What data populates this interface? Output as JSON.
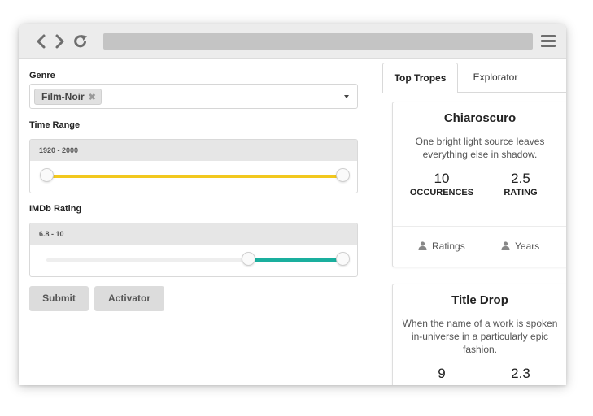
{
  "browser": {
    "icons": [
      "chevron-left-icon",
      "chevron-right-icon",
      "reload-icon",
      "hamburger-menu-icon"
    ]
  },
  "form": {
    "genre_label": "Genre",
    "genre_chip": "Film-Noir",
    "genre_chip_remove": "✖",
    "time_range_label": "Time Range",
    "time_range_value": "1920 - 2000",
    "time_range": {
      "min_fraction": 0.0,
      "max_fraction": 1.0,
      "color": "#f2c81e"
    },
    "imdb_label": "IMDb Rating",
    "imdb_value": "6.8 - 10",
    "imdb": {
      "min_fraction": 0.68,
      "max_fraction": 1.0,
      "color": "#1aaf9e"
    },
    "submit_label": "Submit",
    "activator_label": "Activator"
  },
  "panel": {
    "tabs": [
      {
        "label": "Top Tropes",
        "active": true
      },
      {
        "label": "Explorator",
        "active": false
      }
    ],
    "cards": [
      {
        "title": "Chiaroscuro",
        "description": "One bright light source leaves everything else in shadow.",
        "stat1_value": "10",
        "stat1_label": "OCCURENCES",
        "stat2_value": "2.5",
        "stat2_label": "RATING",
        "foot1": "Ratings",
        "foot2": "Years"
      },
      {
        "title": "Title Drop",
        "description": "When the name of a work is spoken in-universe in a particularly epic fashion.",
        "stat1_value": "9",
        "stat2_value": "2.3"
      }
    ]
  }
}
